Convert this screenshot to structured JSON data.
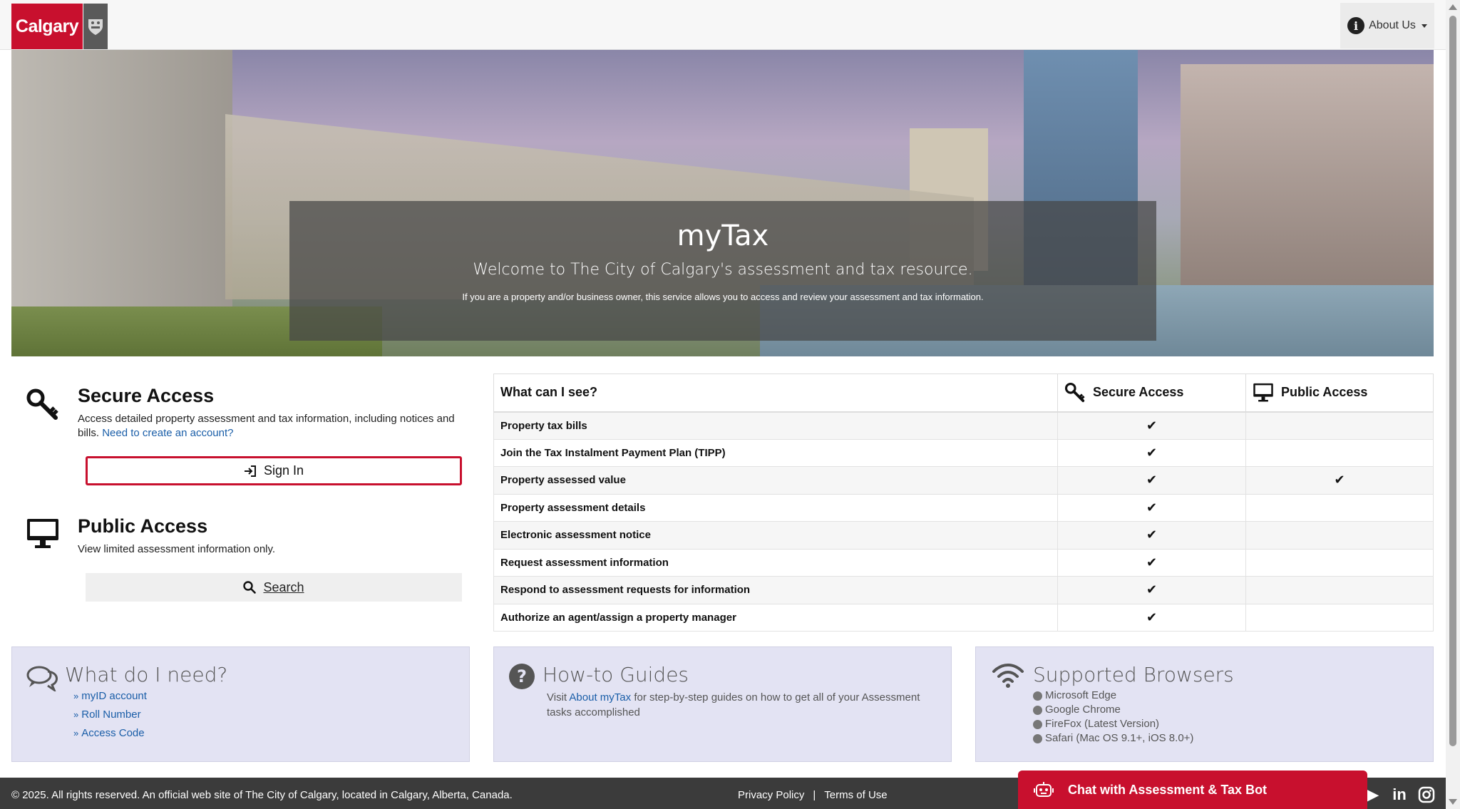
{
  "header": {
    "logo_text": "Calgary",
    "about_label": "About Us"
  },
  "hero": {
    "title": "myTax",
    "subtitle": "Welcome to The City of Calgary's assessment and tax resource.",
    "description": "If you are a property and/or business owner, this service allows you to access and review your assessment and tax information."
  },
  "secure": {
    "title": "Secure Access",
    "description": "Access detailed property assessment and tax information, including notices and bills.",
    "create_link": "Need to create an account?",
    "signin_label": "Sign In"
  },
  "public": {
    "title": "Public Access",
    "description": "View limited assessment information only.",
    "search_label": "Search"
  },
  "table": {
    "headers": [
      "What can I see?",
      "Secure Access",
      "Public Access"
    ],
    "rows": [
      {
        "label": "Property tax bills",
        "secure": "✔",
        "public": ""
      },
      {
        "label": "Join the Tax Instalment Payment Plan (TIPP)",
        "secure": "✔",
        "public": ""
      },
      {
        "label": "Property assessed value",
        "secure": "✔",
        "public": "✔"
      },
      {
        "label": "Property assessment details",
        "secure": "✔",
        "public": ""
      },
      {
        "label": "Electronic assessment notice",
        "secure": "✔",
        "public": ""
      },
      {
        "label": "Request assessment information",
        "secure": "✔",
        "public": ""
      },
      {
        "label": "Respond to assessment requests for information",
        "secure": "✔",
        "public": ""
      },
      {
        "label": "Authorize an agent/assign a property manager",
        "secure": "✔",
        "public": ""
      }
    ]
  },
  "cards": {
    "need": {
      "title": "What do I need?",
      "links": [
        "myID account",
        "Roll Number",
        "Access Code"
      ]
    },
    "guides": {
      "title": "How-to Guides",
      "prefix": "Visit",
      "link": "About myTax",
      "suffix": "for step-by-step guides on how to get all of your Assessment tasks accomplished"
    },
    "browsers": {
      "title": "Supported Browsers",
      "items": [
        "Microsoft Edge",
        "Google Chrome",
        "FireFox (Latest Version)",
        "Safari (Mac OS 9.1+, iOS 8.0+)"
      ]
    }
  },
  "footer": {
    "copyright": "© 2025. All rights reserved. An official web site of The City of Calgary, located in Calgary, Alberta, Canada.",
    "privacy": "Privacy Policy",
    "separator": "|",
    "terms": "Terms of Use"
  },
  "chatbot": {
    "label": "Chat with Assessment & Tax Bot"
  },
  "colors": {
    "brand_red": "#c8102e",
    "link_blue": "#1a5ea8",
    "card_bg": "#e3e3f3",
    "footer_bg": "#3b3b3b"
  }
}
